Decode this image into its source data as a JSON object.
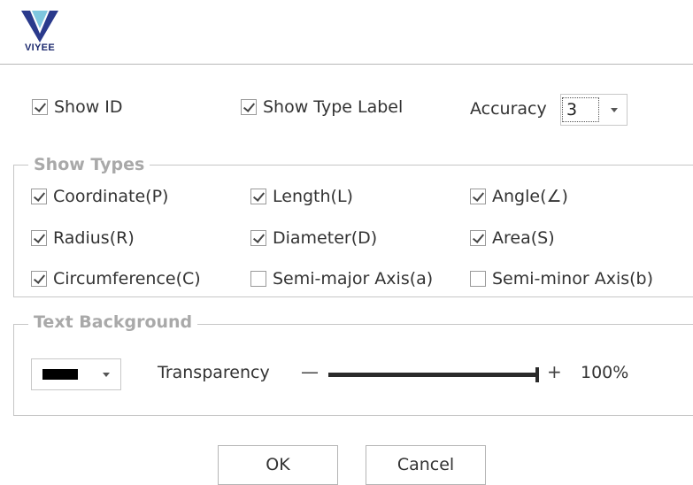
{
  "logo": {
    "text": "VIYEE",
    "colors": [
      "#2a3a8c",
      "#7fc7df"
    ]
  },
  "options": {
    "show_id": {
      "label": "Show ID",
      "checked": true
    },
    "show_type_label": {
      "label": "Show Type Label",
      "checked": true
    },
    "accuracy": {
      "label": "Accuracy",
      "value": "3"
    }
  },
  "show_types": {
    "title": "Show Types",
    "items": [
      {
        "label": "Coordinate(P)",
        "checked": true
      },
      {
        "label": "Length(L)",
        "checked": true
      },
      {
        "label": "Angle(∠)",
        "checked": true
      },
      {
        "label": "Radius(R)",
        "checked": true
      },
      {
        "label": "Diameter(D)",
        "checked": true
      },
      {
        "label": "Area(S)",
        "checked": true
      },
      {
        "label": "Circumference(C)",
        "checked": true
      },
      {
        "label": "Semi-major Axis(a)",
        "checked": false
      },
      {
        "label": "Semi-minor Axis(b)",
        "checked": false
      }
    ]
  },
  "text_background": {
    "title": "Text Background",
    "color": "#000000",
    "transparency_label": "Transparency",
    "minus": "—",
    "plus": "+",
    "transparency_value": 1.0,
    "transparency_text": "100%"
  },
  "buttons": {
    "ok": "OK",
    "cancel": "Cancel"
  }
}
